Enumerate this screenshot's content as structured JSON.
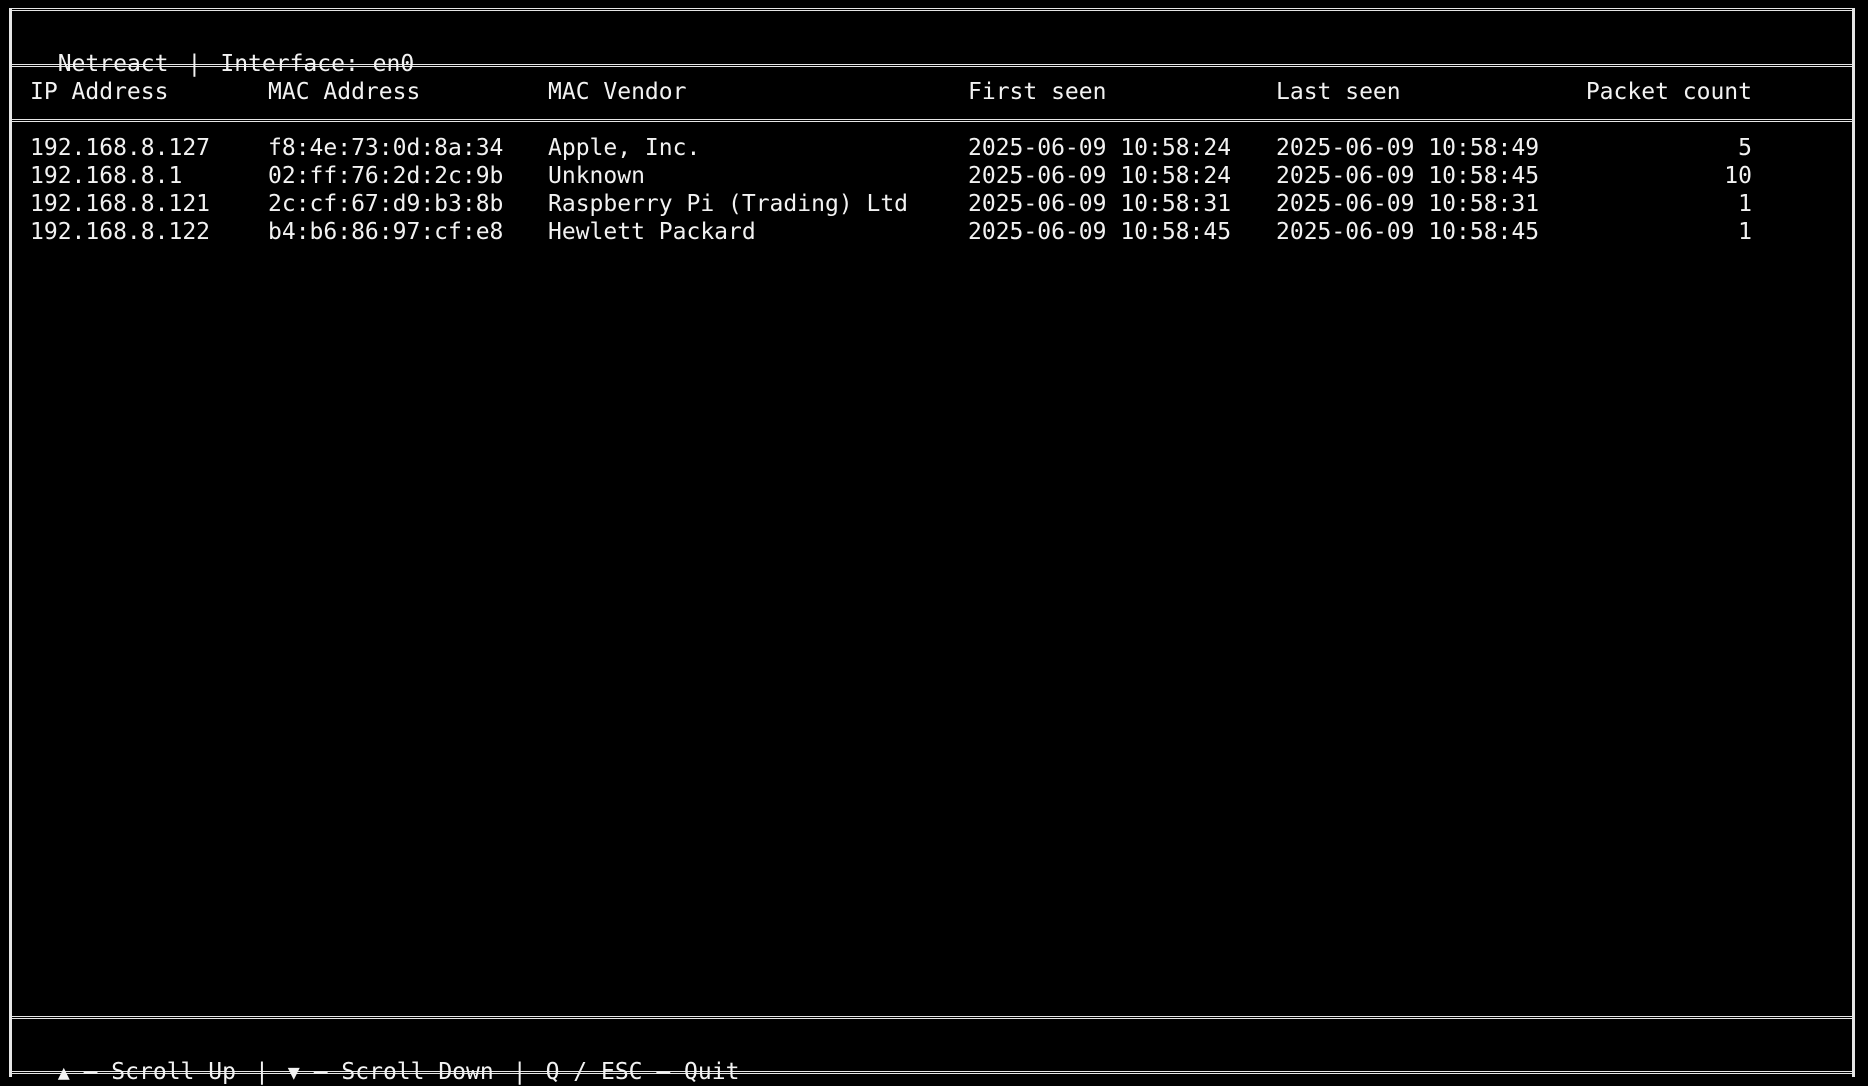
{
  "title": {
    "app_name": "Netreact",
    "separator": "|",
    "interface_label": "Interface: en0"
  },
  "table": {
    "columns": [
      "IP Address",
      "MAC Address",
      "MAC Vendor",
      "First seen",
      "Last seen",
      "Packet count"
    ],
    "rows": [
      {
        "ip": "192.168.8.127",
        "mac": "f8:4e:73:0d:8a:34",
        "vendor": "Apple, Inc.",
        "first_seen": "2025-06-09 10:58:24",
        "last_seen": "2025-06-09 10:58:49",
        "packet_count": "5"
      },
      {
        "ip": "192.168.8.1",
        "mac": "02:ff:76:2d:2c:9b",
        "vendor": "Unknown",
        "first_seen": "2025-06-09 10:58:24",
        "last_seen": "2025-06-09 10:58:45",
        "packet_count": "10"
      },
      {
        "ip": "192.168.8.121",
        "mac": "2c:cf:67:d9:b3:8b",
        "vendor": "Raspberry Pi (Trading) Ltd",
        "first_seen": "2025-06-09 10:58:31",
        "last_seen": "2025-06-09 10:58:31",
        "packet_count": "1"
      },
      {
        "ip": "192.168.8.122",
        "mac": "b4:b6:86:97:cf:e8",
        "vendor": "Hewlett Packard",
        "first_seen": "2025-06-09 10:58:45",
        "last_seen": "2025-06-09 10:58:45",
        "packet_count": "1"
      }
    ]
  },
  "footer": {
    "scroll_up_arrow": "▲",
    "scroll_up_label": "– Scroll Up",
    "scroll_down_arrow": "▼",
    "scroll_down_label": "– Scroll Down",
    "quit_label": "Q / ESC – Quit",
    "separator": "|"
  },
  "colors": {
    "background": "#000000",
    "foreground": "#f2f2f2",
    "border": "#e6e6e6"
  }
}
